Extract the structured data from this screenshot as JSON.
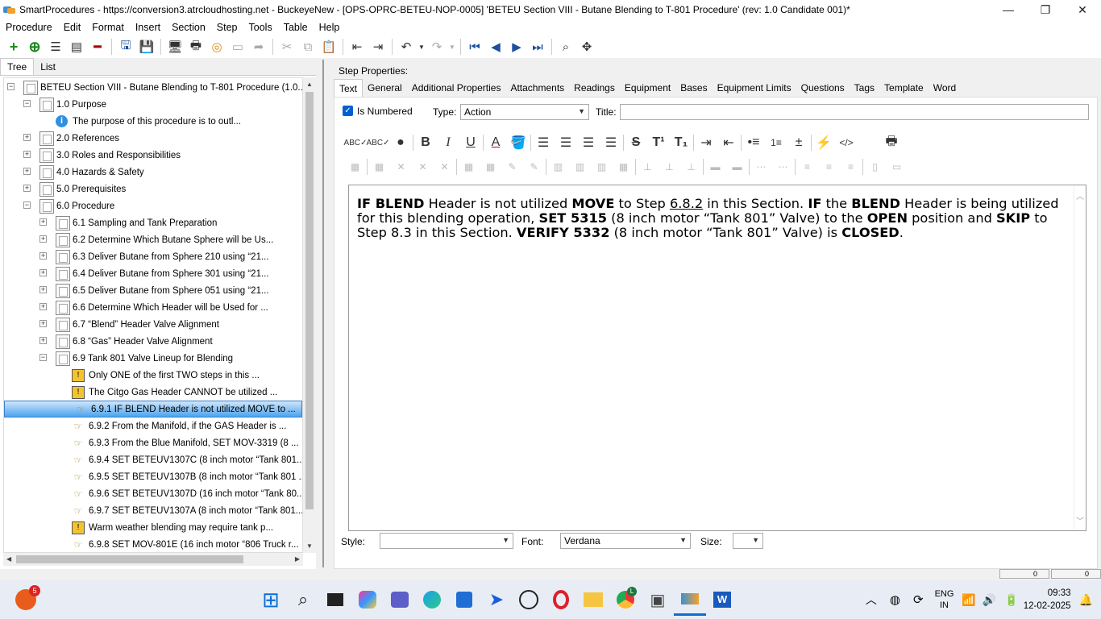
{
  "window": {
    "title": "SmartProcedures - https://conversion3.atrcloudhosting.net - BuckeyeNew - [OPS-OPRC-BETEU-NOP-0005] 'BETEU Section VIII - Butane Blending to T-801 Procedure' (rev: 1.0 Candidate 001)*",
    "minimize": "—",
    "maximize": "❐",
    "close": "✕"
  },
  "menu": [
    "Procedure",
    "Edit",
    "Format",
    "Insert",
    "Section",
    "Step",
    "Tools",
    "Table",
    "Help"
  ],
  "left_tabs": [
    "Tree",
    "List"
  ],
  "tree": [
    {
      "text": "BETEU Section VIII - Butane Blending to T-801 Procedure (1.0...",
      "level": 0,
      "icon": "doc",
      "exp": "−"
    },
    {
      "text": "1.0 Purpose",
      "level": 1,
      "icon": "doc",
      "exp": "−"
    },
    {
      "text": "The purpose of this procedure is to outl...",
      "level": 2,
      "icon": "info",
      "exp": ""
    },
    {
      "text": "2.0 References",
      "level": 1,
      "icon": "doc",
      "exp": "+"
    },
    {
      "text": "3.0 Roles and Responsibilities",
      "level": 1,
      "icon": "doc",
      "exp": "+"
    },
    {
      "text": "4.0 Hazards & Safety",
      "level": 1,
      "icon": "doc",
      "exp": "+"
    },
    {
      "text": "5.0 Prerequisites",
      "level": 1,
      "icon": "doc",
      "exp": "+"
    },
    {
      "text": "6.0 Procedure",
      "level": 1,
      "icon": "doc",
      "exp": "−"
    },
    {
      "text": "6.1 Sampling and Tank Preparation",
      "level": 2,
      "icon": "doc",
      "exp": "+"
    },
    {
      "text": "6.2 Determine Which Butane Sphere will be Us...",
      "level": 2,
      "icon": "doc",
      "exp": "+"
    },
    {
      "text": "6.3 Deliver Butane from Sphere 210 using “21...",
      "level": 2,
      "icon": "doc",
      "exp": "+"
    },
    {
      "text": "6.4 Deliver Butane from Sphere 301 using “21...",
      "level": 2,
      "icon": "doc",
      "exp": "+"
    },
    {
      "text": "6.5 Deliver Butane from Sphere 051 using “21...",
      "level": 2,
      "icon": "doc",
      "exp": "+"
    },
    {
      "text": "6.6 Determine Which Header will be Used for ...",
      "level": 2,
      "icon": "doc",
      "exp": "+"
    },
    {
      "text": "6.7 “Blend” Header Valve Alignment",
      "level": 2,
      "icon": "doc",
      "exp": "+"
    },
    {
      "text": "6.8 “Gas” Header Valve Alignment",
      "level": 2,
      "icon": "doc",
      "exp": "+"
    },
    {
      "text": "6.9 Tank 801 Valve Lineup for Blending",
      "level": 2,
      "icon": "doc",
      "exp": "−"
    },
    {
      "text": "Only ONE of the first TWO steps in this ...",
      "level": 3,
      "icon": "warn",
      "exp": ""
    },
    {
      "text": "The Citgo Gas Header CANNOT be utilized ...",
      "level": 3,
      "icon": "warn",
      "exp": ""
    },
    {
      "text": "6.9.1 IF BLEND Header is not utilized MOVE to ...",
      "level": 3,
      "icon": "hand",
      "exp": "",
      "selected": true
    },
    {
      "text": "6.9.2 From the Manifold, if the GAS Header is ...",
      "level": 3,
      "icon": "hand",
      "exp": ""
    },
    {
      "text": "6.9.3 From the Blue Manifold, SET MOV-3319 (8 ...",
      "level": 3,
      "icon": "hand",
      "exp": ""
    },
    {
      "text": "6.9.4 SET BETEUV1307C (8 inch motor “Tank 801...",
      "level": 3,
      "icon": "hand",
      "exp": ""
    },
    {
      "text": "6.9.5 SET BETEUV1307B (8 inch motor “Tank 801 ...",
      "level": 3,
      "icon": "hand",
      "exp": ""
    },
    {
      "text": "6.9.6 SET BETEUV1307D (16 inch motor “Tank 80...",
      "level": 3,
      "icon": "hand",
      "exp": ""
    },
    {
      "text": "6.9.7 SET BETEUV1307A (8 inch motor “Tank 801...",
      "level": 3,
      "icon": "hand",
      "exp": ""
    },
    {
      "text": "Warm weather blending may require tank p...",
      "level": 3,
      "icon": "warn",
      "exp": ""
    },
    {
      "text": "6.9.8 SET MOV-801E (16 inch motor “806 Truck r...",
      "level": 3,
      "icon": "hand",
      "exp": ""
    }
  ],
  "step_properties": {
    "label": "Step Properties:",
    "tabs": [
      "Text",
      "General",
      "Additional Properties",
      "Attachments",
      "Readings",
      "Equipment",
      "Bases",
      "Equipment Limits",
      "Questions",
      "Tags",
      "Template",
      "Word"
    ],
    "is_numbered_label": "Is Numbered",
    "is_numbered": true,
    "type_label": "Type:",
    "type_value": "Action",
    "title_label": "Title:",
    "title_value": ""
  },
  "step_text": {
    "s1": "IF BLEND",
    "s2": " Header is not utilized ",
    "s3": "MOVE",
    "s4": " to Step ",
    "s5": "6.8.2",
    "s6": " in this Section. ",
    "s7": "IF",
    "s8": " the ",
    "s9": "BLEND",
    "s10": " Header is being utilized for this blending operation, ",
    "s11": "SET 5315",
    "s12": " (8 inch motor “Tank 801” Valve) to the ",
    "s13": "OPEN",
    "s14": " position and ",
    "s15": "SKIP",
    "s16": " to Step 8.3 in this Section. ",
    "s17": "VERIFY 5332",
    "s18": " (8 inch motor “Tank 801” Valve) is ",
    "s19": "CLOSED",
    "s20": "."
  },
  "bottom": {
    "style_label": "Style:",
    "style_value": "",
    "font_label": "Font:",
    "font_value": "Verdana",
    "size_label": "Size:",
    "size_value": ""
  },
  "status": [
    "0",
    "0"
  ],
  "taskbar": {
    "notification_badge": "5",
    "lang_top": "ENG",
    "lang_bottom": "IN",
    "time": "09:33",
    "date": "12-02-2025",
    "chrome_badge": "L"
  }
}
